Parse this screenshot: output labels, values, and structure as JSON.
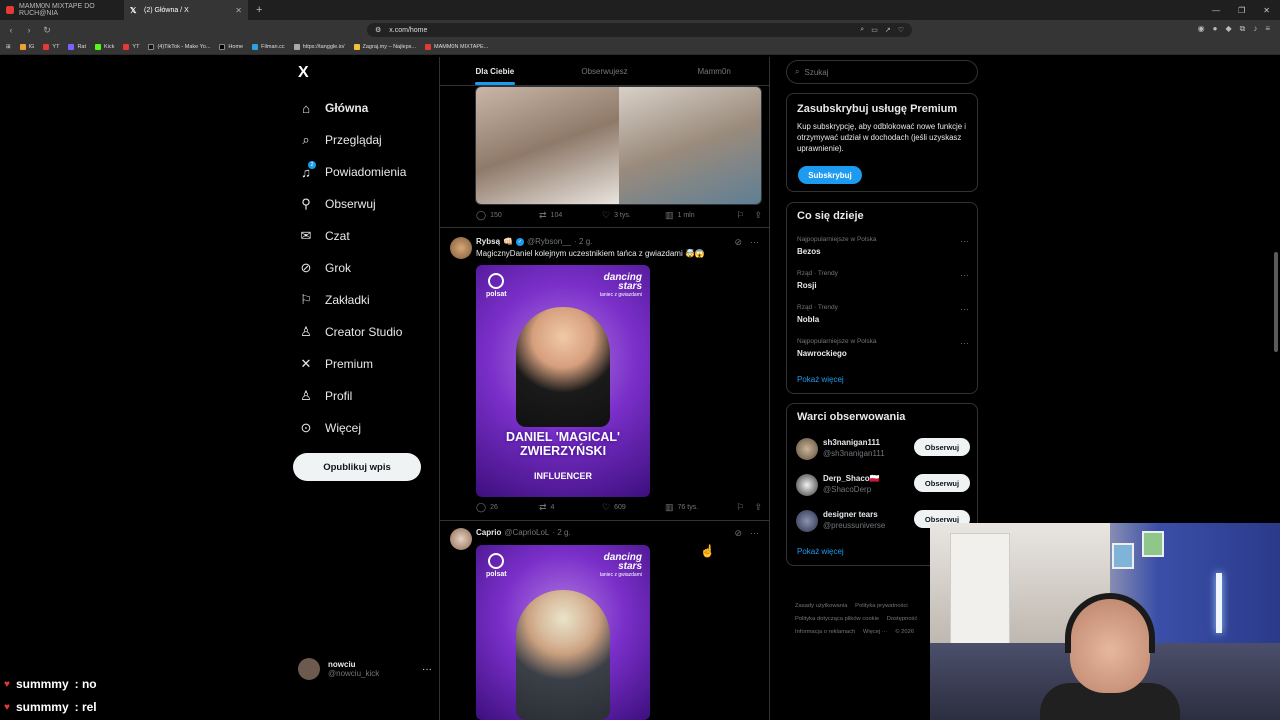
{
  "browser": {
    "tabs": [
      {
        "title": "MAMM0N MIXTAPE DO RUCH@NIA"
      },
      {
        "title": "(2) Główna / X"
      }
    ],
    "url": "x.com/home",
    "bookmarks": [
      "IG",
      "YT",
      "Rat",
      "Kick",
      "YT",
      "(4)TikTok - Make Yo...",
      "Home",
      "Filman.cc",
      "https://tanggle.io/",
      "Zagraj.my – Najleps...",
      "MAMM0N MIXTAPE..."
    ]
  },
  "sidebar": {
    "logo": "X",
    "notification_badge": "2",
    "items": [
      {
        "label": "Główna"
      },
      {
        "label": "Przeglądaj"
      },
      {
        "label": "Powiadomienia"
      },
      {
        "label": "Obserwuj"
      },
      {
        "label": "Czat"
      },
      {
        "label": "Grok"
      },
      {
        "label": "Zakładki"
      },
      {
        "label": "Creator Studio"
      },
      {
        "label": "Premium"
      },
      {
        "label": "Profil"
      },
      {
        "label": "Więcej"
      }
    ],
    "post_button": "Opublikuj wpis",
    "account": {
      "name": "nowciu",
      "handle": "@nowciu_kick"
    }
  },
  "feed": {
    "tabs": [
      {
        "label": "Dla Ciebie"
      },
      {
        "label": "Obserwujesz"
      },
      {
        "label": "Mamm0n"
      }
    ],
    "top_tweet_stats": {
      "replies": "150",
      "reposts": "104",
      "likes": "3 tys.",
      "views": "1 mln"
    },
    "tweets": [
      {
        "name": "Rybsą",
        "handle": "@Rybson__",
        "time": "· 2 g.",
        "text": "MagicznyDaniel kolejnym uczestnikiem tańca z gwiazdami 🤯😱",
        "promo": {
          "brand": "polsat",
          "show": "dancing",
          "show2": "stars",
          "show_sub": "taniec z gwiazdami",
          "person": "DANIEL 'MAGICAL' ZWIERZYŃSKI",
          "category": "INFLUENCER"
        },
        "stats": {
          "replies": "26",
          "reposts": "4",
          "likes": "609",
          "views": "76 tys."
        }
      },
      {
        "name": "Caprio",
        "handle": "@CaprioLoL",
        "time": "· 2 g.",
        "promo": {
          "brand": "polsat",
          "show": "dancing",
          "show2": "stars",
          "show_sub": "taniec z gwiazdami"
        }
      }
    ]
  },
  "right": {
    "search_placeholder": "Szukaj",
    "premium": {
      "title": "Zasubskrybuj usługę Premium",
      "text": "Kup subskrypcję, aby odblokować nowe funkcje i otrzymywać udział w dochodach (jeśli uzyskasz uprawnienie).",
      "button": "Subskrybuj"
    },
    "trends": {
      "title": "Co się dzieje",
      "items": [
        {
          "context": "Najpopularniejsze w Polska",
          "name": "Bezos"
        },
        {
          "context": "Rząd · Trendy",
          "name": "Rosji"
        },
        {
          "context": "Rząd · Trendy",
          "name": "Nobla"
        },
        {
          "context": "Najpopularniejsze w Polska",
          "name": "Nawrockiego"
        }
      ],
      "show_more": "Pokaż więcej"
    },
    "who_to_follow": {
      "title": "Warci obserwowania",
      "users": [
        {
          "name": "sh3nanigan111",
          "handle": "@sh3nanigan111"
        },
        {
          "name": "Derp_Shaco🇵🇱",
          "handle": "@ShacoDerp"
        },
        {
          "name": "designer tears",
          "handle": "@preussuniverse"
        }
      ],
      "follow_label": "Obserwuj",
      "show_more": "Pokaż więcej"
    },
    "footer": [
      "Zasady użytkowania",
      "Polityka prywatności",
      "Polityka dotycząca plików cookie",
      "Dostępność",
      "Informacja o reklamach",
      "Więcej ···",
      "© 2026"
    ]
  },
  "chat": [
    {
      "user": "summmy",
      "message": ": no"
    },
    {
      "user": "summmy",
      "message": ": rel"
    }
  ],
  "colors": {
    "accent": "#1d9bf0",
    "background": "#000000",
    "border": "#2f3336",
    "muted": "#71767b"
  }
}
